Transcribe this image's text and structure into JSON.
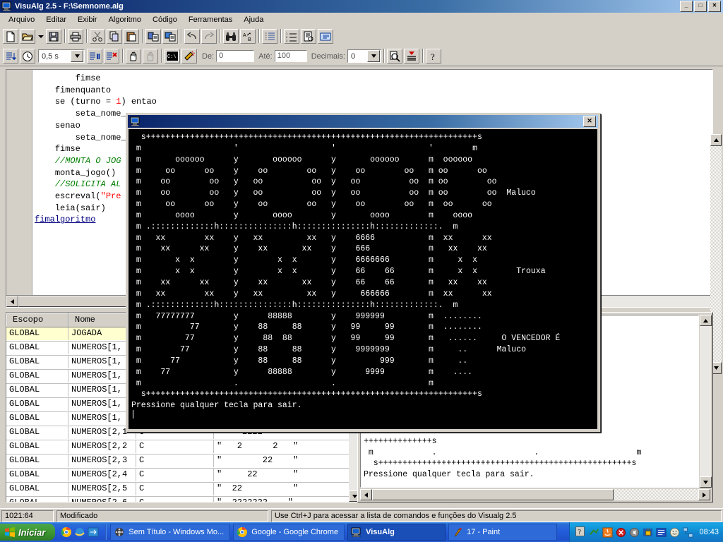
{
  "window": {
    "title": "VisuAlg 2.5 - F:\\Semnome.alg",
    "icon": "computer-icon",
    "buttons": {
      "minimize": "_",
      "maximize": "□",
      "close": "✕"
    }
  },
  "menu": {
    "items": [
      "Arquivo",
      "Editar",
      "Exibir",
      "Algoritmo",
      "Código",
      "Ferramentas",
      "Ajuda"
    ]
  },
  "toolbar1": {
    "buttons": [
      {
        "name": "new-file-icon",
        "glyph": "⬜"
      },
      {
        "name": "open-file-icon",
        "glyph": "📂"
      },
      {
        "name": "open-dropdown-icon",
        "glyph": "▾"
      },
      {
        "name": "save-file-icon",
        "glyph": "💾"
      },
      {
        "name": "print-icon",
        "glyph": "🖨"
      },
      {
        "name": "cut-icon",
        "glyph": "✂"
      },
      {
        "name": "copy-icon",
        "glyph": "⧉"
      },
      {
        "name": "paste-icon",
        "glyph": "📋"
      },
      {
        "name": "copy-formatted-icon",
        "glyph": "⎘"
      },
      {
        "name": "paste-formatted-icon",
        "glyph": "⎙"
      },
      {
        "name": "undo-icon",
        "glyph": "↶"
      },
      {
        "name": "redo-icon",
        "glyph": "↷"
      },
      {
        "name": "find-icon",
        "glyph": "🔍"
      },
      {
        "name": "replace-icon",
        "glyph": "A→B"
      },
      {
        "name": "indent-icon",
        "glyph": "⇥"
      },
      {
        "name": "numbering-icon",
        "glyph": "≡"
      },
      {
        "name": "print-preview-icon",
        "glyph": "📄"
      },
      {
        "name": "insert-comment-icon",
        "glyph": "▤"
      }
    ]
  },
  "toolbar2": {
    "buttons": [
      {
        "name": "run-icon",
        "glyph": "▤↓"
      },
      {
        "name": "run-timed-icon",
        "glyph": "⏱"
      },
      {
        "name": "pause-icon",
        "glyph": "▌█"
      },
      {
        "name": "stop-icon",
        "glyph": "✖"
      },
      {
        "name": "step-over-icon",
        "glyph": "✋"
      },
      {
        "name": "step-into-icon",
        "glyph": "🖐"
      },
      {
        "name": "console-icon",
        "glyph": "C:\\"
      },
      {
        "name": "highlight-icon",
        "glyph": "🖊"
      },
      {
        "name": "zoom-icon",
        "glyph": "🔎"
      },
      {
        "name": "data-table-icon",
        "glyph": "☰"
      },
      {
        "name": "help-icon",
        "glyph": "?"
      }
    ],
    "speed_value": "0,5 s",
    "de_label": "De:",
    "de_value": "0",
    "ate_label": "Até:",
    "ate_value": "100",
    "decimais_label": "Decimais:",
    "decimais_value": "0"
  },
  "editor": {
    "lines": [
      {
        "indent": 8,
        "segments": [
          {
            "t": "fimse",
            "c": "kw"
          }
        ]
      },
      {
        "indent": 4,
        "segments": [
          {
            "t": "fimenquanto",
            "c": "kw"
          }
        ]
      },
      {
        "indent": 4,
        "segments": [
          {
            "t": "se (turno = ",
            "c": "kw"
          },
          {
            "t": "1",
            "c": "num"
          },
          {
            "t": ") entao",
            "c": "kw"
          }
        ]
      },
      {
        "indent": 8,
        "segments": [
          {
            "t": "seta_nome_",
            "c": "kw"
          }
        ]
      },
      {
        "indent": 4,
        "segments": [
          {
            "t": "senao",
            "c": "kw"
          }
        ]
      },
      {
        "indent": 8,
        "segments": [
          {
            "t": "seta_nome_",
            "c": "kw"
          }
        ]
      },
      {
        "indent": 4,
        "segments": [
          {
            "t": "fimse",
            "c": "kw"
          }
        ]
      },
      {
        "indent": 4,
        "segments": [
          {
            "t": "//MONTA O JOG",
            "c": "cmt"
          }
        ]
      },
      {
        "indent": 4,
        "segments": [
          {
            "t": "monta_jogo()",
            "c": "kw"
          }
        ]
      },
      {
        "indent": 4,
        "segments": [
          {
            "t": "//SOLICITA AL",
            "c": "cmt"
          }
        ]
      },
      {
        "indent": 4,
        "segments": [
          {
            "t": "escreval(",
            "c": "kw"
          },
          {
            "t": "\"Pre",
            "c": "str"
          }
        ]
      },
      {
        "indent": 4,
        "segments": [
          {
            "t": "leia(sair)",
            "c": "kw"
          }
        ]
      },
      {
        "indent": 0,
        "segments": [
          {
            "t": "fimalgoritmo",
            "c": "fim"
          }
        ]
      }
    ]
  },
  "vargrid": {
    "headers": [
      "Escopo",
      "Nome",
      "",
      ""
    ],
    "rows": [
      {
        "escopo": "GLOBAL",
        "nome": "JOGADA",
        "tipo": "",
        "valor": "",
        "selected": true
      },
      {
        "escopo": "GLOBAL",
        "nome": "NUMEROS[1,",
        "tipo": "",
        "valor": "",
        "selected": false
      },
      {
        "escopo": "GLOBAL",
        "nome": "NUMEROS[1,",
        "tipo": "",
        "valor": "",
        "selected": false
      },
      {
        "escopo": "GLOBAL",
        "nome": "NUMEROS[1,",
        "tipo": "",
        "valor": "",
        "selected": false
      },
      {
        "escopo": "GLOBAL",
        "nome": "NUMEROS[1,",
        "tipo": "",
        "valor": "",
        "selected": false
      },
      {
        "escopo": "GLOBAL",
        "nome": "NUMEROS[1,",
        "tipo": "",
        "valor": "",
        "selected": false
      },
      {
        "escopo": "GLOBAL",
        "nome": "NUMEROS[1,",
        "tipo": "",
        "valor": "",
        "selected": false
      },
      {
        "escopo": "GLOBAL",
        "nome": "NUMEROS[2,1",
        "tipo": "C",
        "valor": "\"    2222    \"",
        "selected": false
      },
      {
        "escopo": "GLOBAL",
        "nome": "NUMEROS[2,2",
        "tipo": "C",
        "valor": "\"   2      2   \"",
        "selected": false
      },
      {
        "escopo": "GLOBAL",
        "nome": "NUMEROS[2,3",
        "tipo": "C",
        "valor": "\"        22    \"",
        "selected": false
      },
      {
        "escopo": "GLOBAL",
        "nome": "NUMEROS[2,4",
        "tipo": "C",
        "valor": "\"     22       \"",
        "selected": false
      },
      {
        "escopo": "GLOBAL",
        "nome": "NUMEROS[2,5",
        "tipo": "C",
        "valor": "\"  22          \"",
        "selected": false
      },
      {
        "escopo": "GLOBAL",
        "nome": "NUMEROS[2,6",
        "tipo": "C",
        "valor": "\"  2222222    \"",
        "selected": false
      }
    ]
  },
  "console_window": {
    "title": "",
    "icon": "computer-icon",
    "close_label": "✕",
    "text": "  s++++++++++++++++++++++++++++++++++++++++++++++++++++++++++++++++++++s\n m                   '                   '                   '        m\n m       oooooo      y       oooooo      y       oooooo      m  oooooo\n m     oo      oo    y    oo        oo   y    oo        oo   m oo      oo\n m    oo        oo   y   oo          oo  y   oo          oo  m oo        oo\n m    oo        oo   y   oo          oo  y   oo          oo  m oo        oo  Maluco\n m     oo      oo    y    oo        oo   y    oo        oo   m  oo      oo\n m       oooo        y       oooo        y       oooo        m    oooo\n m .:::::::::::::h:::::::::::::::h:::::::::::::::h:::::::::::::.  m\n m   xx        xx    y   xx         xx   y    6666           m  xx      xx\n m    xx      xx     y    xx       xx    y    666            m   xx    xx\n m       x  x        y        x  x       y    6666666        m     x  x\n m       x  x        y        x  x       y    66    66       m     x  x        Trouxa\n m    xx      xx     y    xx       xx    y    66    66       m   xx    xx\n m   xx        xx    y   xx         xx   y     666666        m  xx      xx\n m .:::::::::::::h:::::::::::::::h:::::::::::::::h:::::::::::::.  m\n m   77777777        y      88888        y    999999         m  ........\n m          77       y    88     88      y   99     99       m  ........\n m         77        y     88  88        y   99     99       m   ......     O VENCEDOR É\n m        77         y    88     88      y    9999999        m     ..      Maluco\n m      77           y    88     88      y         999       m     ..\n m    77             y      88888        y      9999         m    ....\n m                   .                   .                   m\n  s++++++++++++++++++++++++++++++++++++++++++++++++++++++++++++++++++++s\nPressione qualquer tecla para sair."
  },
  "output_window": {
    "text": "6      66        m        x\n6      66        m     xx\n666666           m    xx\n..........       m\n999999           m    .....\n9      99        m    .....\n9      99        m     ....\n9999999          m       ..\n      999        m       ..\n  9999           m      ...\n                 m\n++++++++++++++s\n m            .                    .                    m\n  s++++++++++++++++++++++++++++++++++++++++++++++++++++s\nPressione qualquer tecla para sair."
  },
  "statusbar": {
    "position": "1021:64",
    "modified": "Modificado",
    "hint": "Use Ctrl+J para acessar a lista de comandos e funções do Visualg 2.5"
  },
  "taskbar": {
    "start_label": "Iniciar",
    "quicklaunch": [
      {
        "name": "chrome-quicklaunch-icon"
      },
      {
        "name": "internet-explorer-quicklaunch-icon"
      },
      {
        "name": "show-desktop-quicklaunch-icon"
      }
    ],
    "tasks": [
      {
        "label": "Sem Título - Windows Mo...",
        "icon": "movie-maker-icon",
        "active": false
      },
      {
        "label": "Google - Google Chrome",
        "icon": "chrome-icon",
        "active": false
      },
      {
        "label": "VisuAlg",
        "icon": "computer-icon",
        "active": true
      },
      {
        "label": "17 - Paint",
        "icon": "paint-icon",
        "active": false
      }
    ],
    "tray_icons": [
      {
        "name": "help-tray-icon"
      },
      {
        "name": "network-tray-icon"
      },
      {
        "name": "java-tray-icon"
      },
      {
        "name": "antivirus-tray-icon"
      },
      {
        "name": "volume-tray-icon"
      },
      {
        "name": "security-tray-icon"
      },
      {
        "name": "update-tray-icon"
      },
      {
        "name": "messenger-tray-icon"
      },
      {
        "name": "network-connection-tray-icon"
      }
    ],
    "clock": "08:43"
  },
  "colors": {
    "desktop": "#3a6ea5",
    "window_face": "#d4d0c8",
    "title_active": "#0a246a",
    "console_bg": "#000000",
    "console_fg": "#ffffff",
    "comment": "#008000",
    "string": "#ff0000",
    "keyword_link": "#000080",
    "selected_row": "#ffffd0",
    "taskbar": "#245edc",
    "start_green": "#3f9a33"
  }
}
